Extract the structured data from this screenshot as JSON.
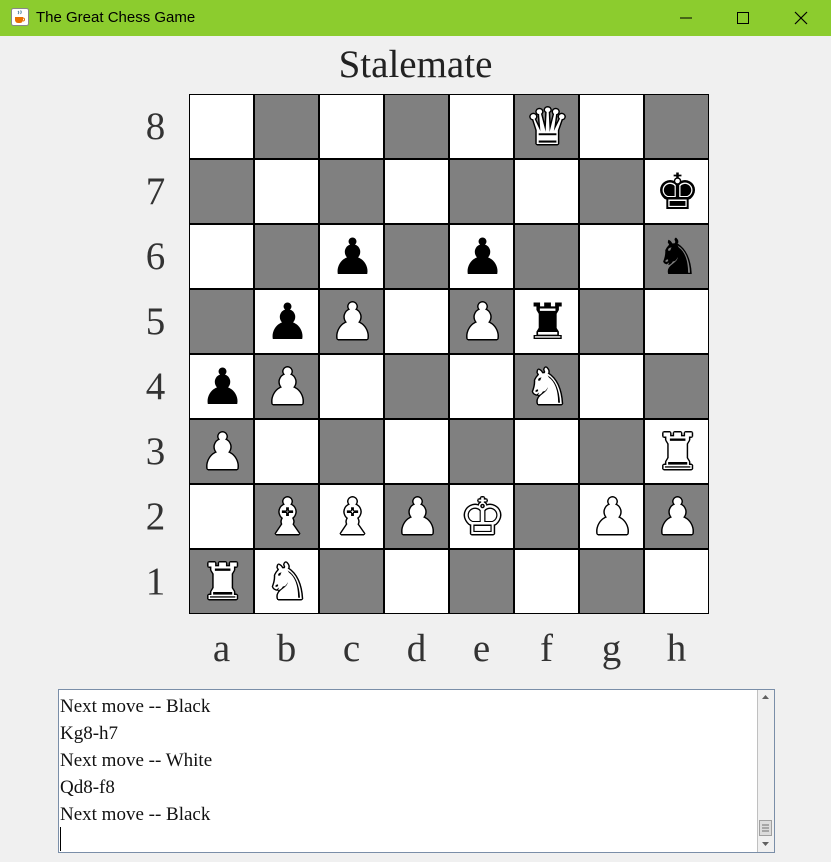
{
  "window": {
    "title": "The Great Chess Game",
    "icon": "java-coffee-cup-icon",
    "controls": [
      "minimize-icon",
      "maximize-icon",
      "close-icon"
    ],
    "titlebar_color": "#8ccc2e"
  },
  "status": "Stalemate",
  "board": {
    "light_color": "#ffffff",
    "dark_color": "#808080",
    "ranks": [
      "8",
      "7",
      "6",
      "5",
      "4",
      "3",
      "2",
      "1"
    ],
    "files": [
      "a",
      "b",
      "c",
      "d",
      "e",
      "f",
      "g",
      "h"
    ],
    "pieces": [
      {
        "square": "f8",
        "color": "white",
        "type": "queen"
      },
      {
        "square": "h7",
        "color": "black",
        "type": "king"
      },
      {
        "square": "c6",
        "color": "black",
        "type": "pawn"
      },
      {
        "square": "e6",
        "color": "black",
        "type": "pawn"
      },
      {
        "square": "h6",
        "color": "black",
        "type": "knight"
      },
      {
        "square": "b5",
        "color": "black",
        "type": "pawn"
      },
      {
        "square": "c5",
        "color": "white",
        "type": "pawn"
      },
      {
        "square": "e5",
        "color": "white",
        "type": "pawn"
      },
      {
        "square": "f5",
        "color": "black",
        "type": "rook"
      },
      {
        "square": "a4",
        "color": "black",
        "type": "pawn"
      },
      {
        "square": "b4",
        "color": "white",
        "type": "pawn"
      },
      {
        "square": "f4",
        "color": "white",
        "type": "knight"
      },
      {
        "square": "a3",
        "color": "white",
        "type": "pawn"
      },
      {
        "square": "h3",
        "color": "white",
        "type": "rook"
      },
      {
        "square": "b2",
        "color": "white",
        "type": "bishop"
      },
      {
        "square": "c2",
        "color": "white",
        "type": "bishop"
      },
      {
        "square": "d2",
        "color": "white",
        "type": "pawn"
      },
      {
        "square": "e2",
        "color": "white",
        "type": "king"
      },
      {
        "square": "g2",
        "color": "white",
        "type": "pawn"
      },
      {
        "square": "h2",
        "color": "white",
        "type": "pawn"
      },
      {
        "square": "a1",
        "color": "white",
        "type": "rook"
      },
      {
        "square": "b1",
        "color": "white",
        "type": "knight"
      }
    ]
  },
  "log": {
    "lines": [
      "Next move -- Black",
      "Kg8-h7",
      "Next move -- White",
      "Qd8-f8",
      "Next move -- Black"
    ]
  }
}
